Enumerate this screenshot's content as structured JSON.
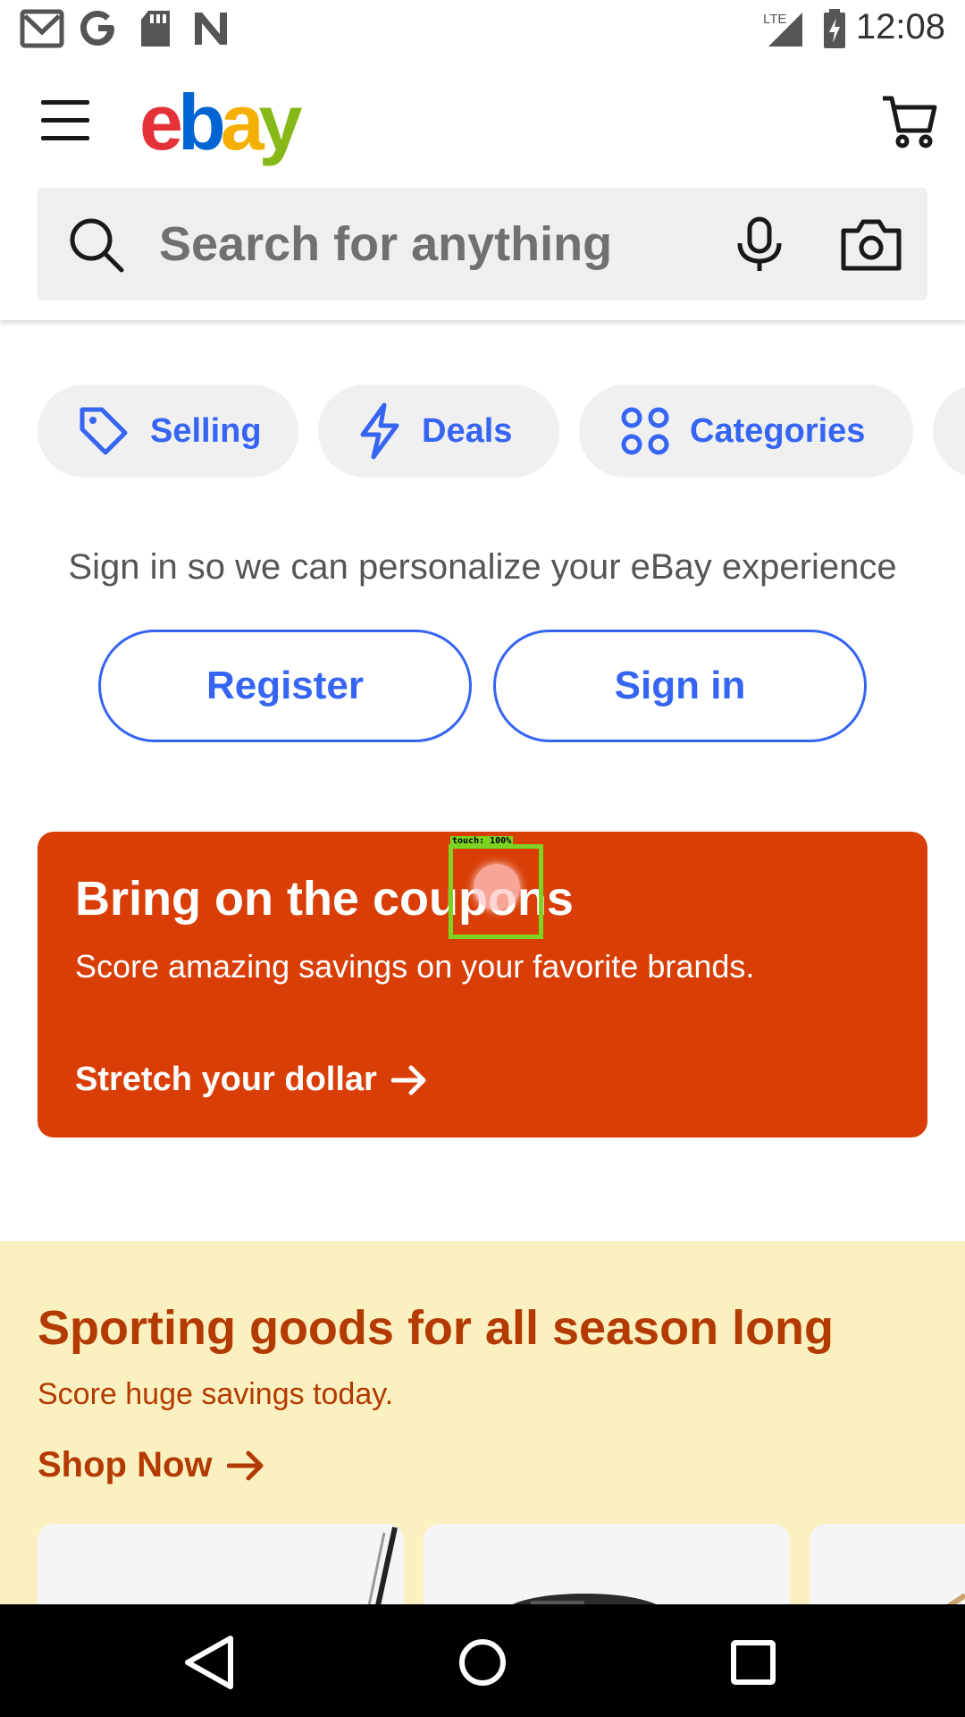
{
  "status_bar": {
    "time": "12:08",
    "network": "LTE",
    "left_icons": [
      "gmail-icon",
      "google-icon",
      "sd-card-icon",
      "n-icon"
    ],
    "right_icons": [
      "signal-icon",
      "battery-charging-icon"
    ]
  },
  "header": {
    "logo": {
      "e": "e",
      "b": "b",
      "a": "a",
      "y": "y"
    },
    "colors": {
      "e": "#e53238",
      "b": "#0064d2",
      "a": "#f5af02",
      "y": "#86b817"
    }
  },
  "search": {
    "placeholder": "Search for anything",
    "value": ""
  },
  "chips": {
    "selling": "Selling",
    "deals": "Deals",
    "categories": "Categories"
  },
  "signin": {
    "prompt": "Sign in so we can personalize your eBay experience",
    "register_label": "Register",
    "signin_label": "Sign in"
  },
  "coupon_banner": {
    "title": "Bring on the coupons",
    "subtitle": "Score amazing savings on your favorite brands.",
    "cta": "Stretch your dollar",
    "bg_color": "#d93e06"
  },
  "touch_overlay": {
    "label": "touch: 100%"
  },
  "sporting": {
    "title": "Sporting goods for all season long",
    "subtitle": "Score huge savings today.",
    "cta": "Shop Now",
    "bg_color": "#faf0c0",
    "text_color": "#b33a00"
  },
  "accent_color": "#3665f3"
}
